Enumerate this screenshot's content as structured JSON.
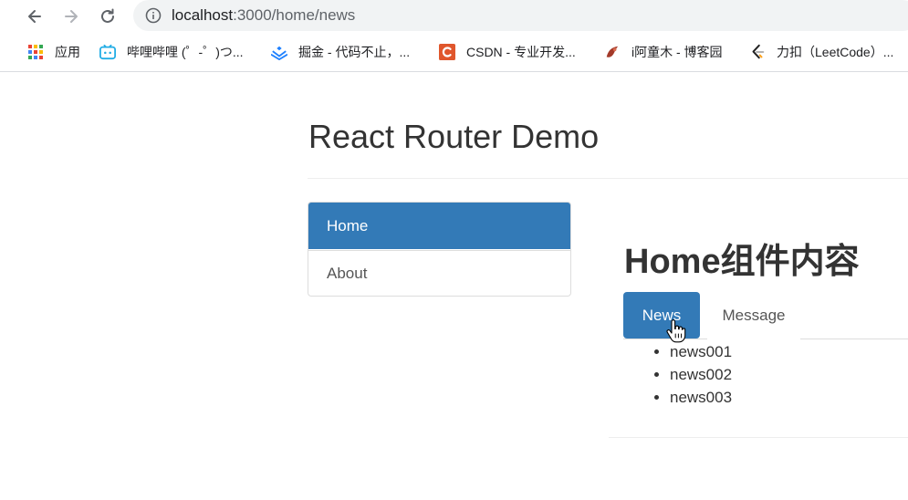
{
  "browser": {
    "url_host": "localhost",
    "url_rest": ":3000/home/news",
    "bookmarks": [
      {
        "label": "应用",
        "icon": "apps-grid-icon"
      },
      {
        "label": "哔哩哔哩 (゜-゜)つ...",
        "icon": "bilibili-icon"
      },
      {
        "label": "掘金 - 代码不止，...",
        "icon": "juejin-icon"
      },
      {
        "label": "CSDN - 专业开发...",
        "icon": "csdn-icon"
      },
      {
        "label": "i阿童木 - 博客园",
        "icon": "cnblogs-icon"
      },
      {
        "label": "力扣（LeetCode）...",
        "icon": "leetcode-icon"
      }
    ]
  },
  "page": {
    "title": "React Router Demo",
    "sidenav": [
      {
        "label": "Home",
        "active": true
      },
      {
        "label": "About",
        "active": false
      }
    ],
    "home": {
      "heading": "Home组件内容",
      "tabs": [
        {
          "label": "News",
          "active": true
        },
        {
          "label": "Message",
          "active": false
        }
      ],
      "news": [
        "news001",
        "news002",
        "news003"
      ]
    }
  },
  "colors": {
    "primary": "#337ab7",
    "border": "#dddddd",
    "text": "#333333"
  }
}
